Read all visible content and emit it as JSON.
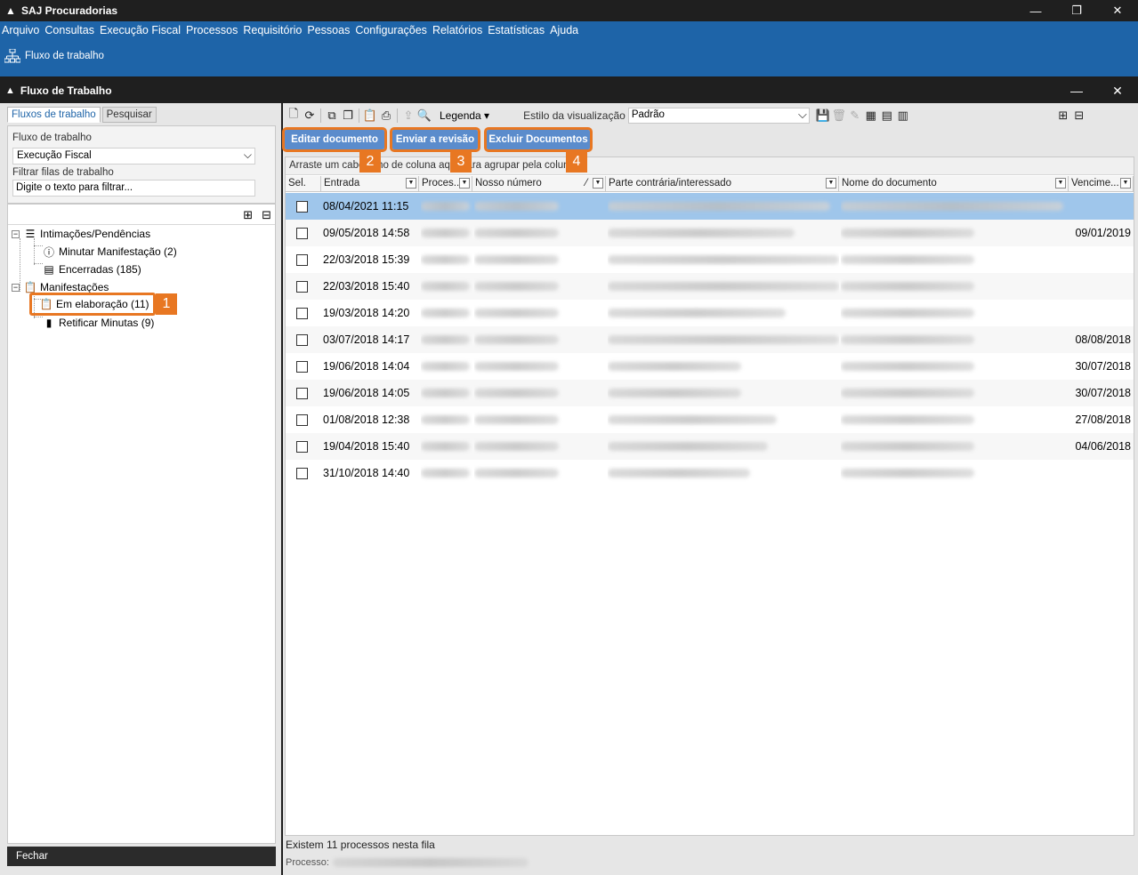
{
  "app": {
    "title": "SAJ Procuradorias"
  },
  "menu": [
    "Arquivo",
    "Consultas",
    "Execução Fiscal",
    "Processos",
    "Requisitório",
    "Pessoas",
    "Configurações",
    "Relatórios",
    "Estatísticas",
    "Ajuda"
  ],
  "quick_bar": {
    "label": "Fluxo de trabalho",
    "icon": "workflow-icon"
  },
  "window": {
    "title": "Fluxo de Trabalho"
  },
  "left": {
    "tabs": [
      "Fluxos de trabalho",
      "Pesquisar"
    ],
    "flow_label": "Fluxo de trabalho",
    "flow_value": "Execução Fiscal",
    "filter_label": "Filtrar filas de trabalho",
    "filter_value": "Digite o texto para filtrar...",
    "tree": {
      "intimacoes": "Intimações/Pendências",
      "minutar": "Minutar Manifestação (2)",
      "encerradas": "Encerradas (185)",
      "manifestacoes": "Manifestações",
      "em_elaboracao": "Em elaboração (11)",
      "retificar": "Retificar Minutas (9)"
    },
    "close_label": "Fechar"
  },
  "toolbar": {
    "legend": "Legenda",
    "view_label": "Estilo da visualização",
    "view_value": "Padrão"
  },
  "actions": {
    "edit": "Editar documento",
    "review": "Enviar a revisão",
    "delete": "Excluir Documentos"
  },
  "badges": [
    "1",
    "2",
    "3",
    "4"
  ],
  "accent_color": "#e87722",
  "grid": {
    "group_hint": "Arraste um cabeçalho de coluna aqui para agrupar pela coluna",
    "columns": [
      "Sel.",
      "Entrada",
      "Proces...",
      "Nosso número",
      "Parte contrária/interessado",
      "Nome do documento",
      "Vencime..."
    ],
    "rows": [
      {
        "entrada": "08/04/2021 11:15",
        "vencimento": ""
      },
      {
        "entrada": "09/05/2018 14:58",
        "vencimento": "09/01/2019"
      },
      {
        "entrada": "22/03/2018 15:39",
        "vencimento": ""
      },
      {
        "entrada": "22/03/2018 15:40",
        "vencimento": ""
      },
      {
        "entrada": "19/03/2018 14:20",
        "vencimento": ""
      },
      {
        "entrada": "03/07/2018 14:17",
        "vencimento": "08/08/2018"
      },
      {
        "entrada": "19/06/2018 14:04",
        "vencimento": "30/07/2018"
      },
      {
        "entrada": "19/06/2018 14:05",
        "vencimento": "30/07/2018"
      },
      {
        "entrada": "01/08/2018 12:38",
        "vencimento": "27/08/2018"
      },
      {
        "entrada": "19/04/2018 15:40",
        "vencimento": "04/06/2018"
      },
      {
        "entrada": "31/10/2018 14:40",
        "vencimento": ""
      }
    ]
  },
  "status": {
    "count_text": "Existem 11 processos nesta fila",
    "process_label": "Processo:"
  }
}
